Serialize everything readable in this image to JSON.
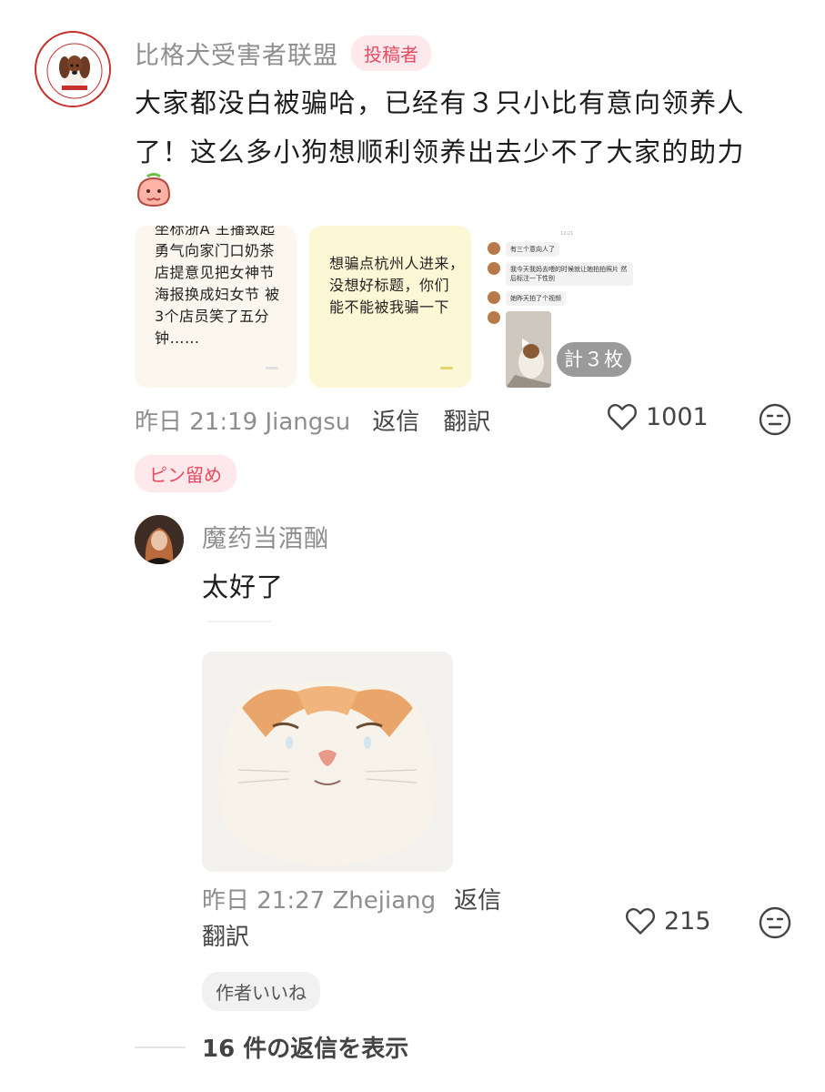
{
  "comment": {
    "author": "比格犬受害者联盟",
    "author_badge": "投稿者",
    "text": "大家都没白被骗哈，已经有３只小比有意向领养人了！这么多小狗想顺利领养出去少不了大家的助力",
    "images": {
      "card1_text": "坐标浙A 主播致起\n勇气向家门口奶茶\n店提意见把女神节\n海报换成妇女节 被\n3个店员笑了五分\n钟……",
      "card2_text": "想骗点杭州人进来，\n没想好标题，你们\n能不能被我骗一下",
      "card3_time": "12:21",
      "card3_messages": [
        "有三个意向人了",
        "我今天我妈去喂的时候就让她拍拍照片 然后标注一下性别",
        "她昨天拍了个视频"
      ],
      "count_label": "計３枚"
    },
    "time": "昨日 21:19 Jiangsu",
    "reply_label": "返信",
    "translate_label": "翻訳",
    "likes": "1001",
    "pin_label": "ピン留め"
  },
  "reply": {
    "author": "魔药当酒酗",
    "text": "太好了",
    "time": "昨日 21:27 Zhejiang",
    "reply_label": "返信",
    "translate_label": "翻訳",
    "likes": "215",
    "author_liked_label": "作者いいね"
  },
  "show_replies": "16 件の返信を表示",
  "colors": {
    "accent": "#e84a5f",
    "muted": "#8e8e8e"
  },
  "icons": [
    "heart-icon",
    "face-emoji-icon",
    "play-icon",
    "pig-emoji-icon"
  ]
}
